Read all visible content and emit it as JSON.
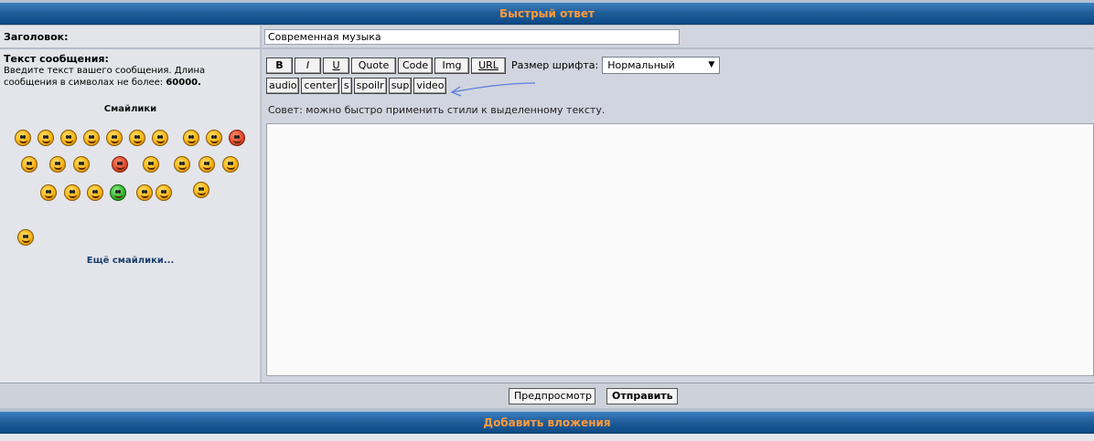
{
  "quick_reply": {
    "header": "Быстрый ответ",
    "title_label": "Заголовок:",
    "title_value": "Современная музыка",
    "message_label": "Текст сообщения:",
    "message_desc_prefix": "Введите текст вашего сообщения. Длина сообщения в символах не более: ",
    "message_max": "60000.",
    "smilies_title": "Смайлики",
    "more_smilies": "Ещё смайлики...",
    "toolbar_row1": {
      "bold": "B",
      "italic": "I",
      "underline": "U",
      "quote": "Quote",
      "code": "Code",
      "img": "Img",
      "url": "URL"
    },
    "fontsize_label": "Размер шрифта:",
    "fontsize_value": "Нормальный",
    "toolbar_row2": [
      "audio",
      "center",
      "s",
      "spoilr",
      "sup",
      "video"
    ],
    "hint": "Совет: можно быстро применить стили к выделенному тексту.",
    "message_value": "",
    "preview_label": "Предпросмотр",
    "submit_label": "Отправить"
  },
  "attachments": {
    "header": "Добавить вложения"
  },
  "colors": {
    "header_text": "#ff9a3c",
    "header_bg": "#1f5d99",
    "link": "#1c3f6e",
    "annotation_arrow": "#5a7de0"
  }
}
